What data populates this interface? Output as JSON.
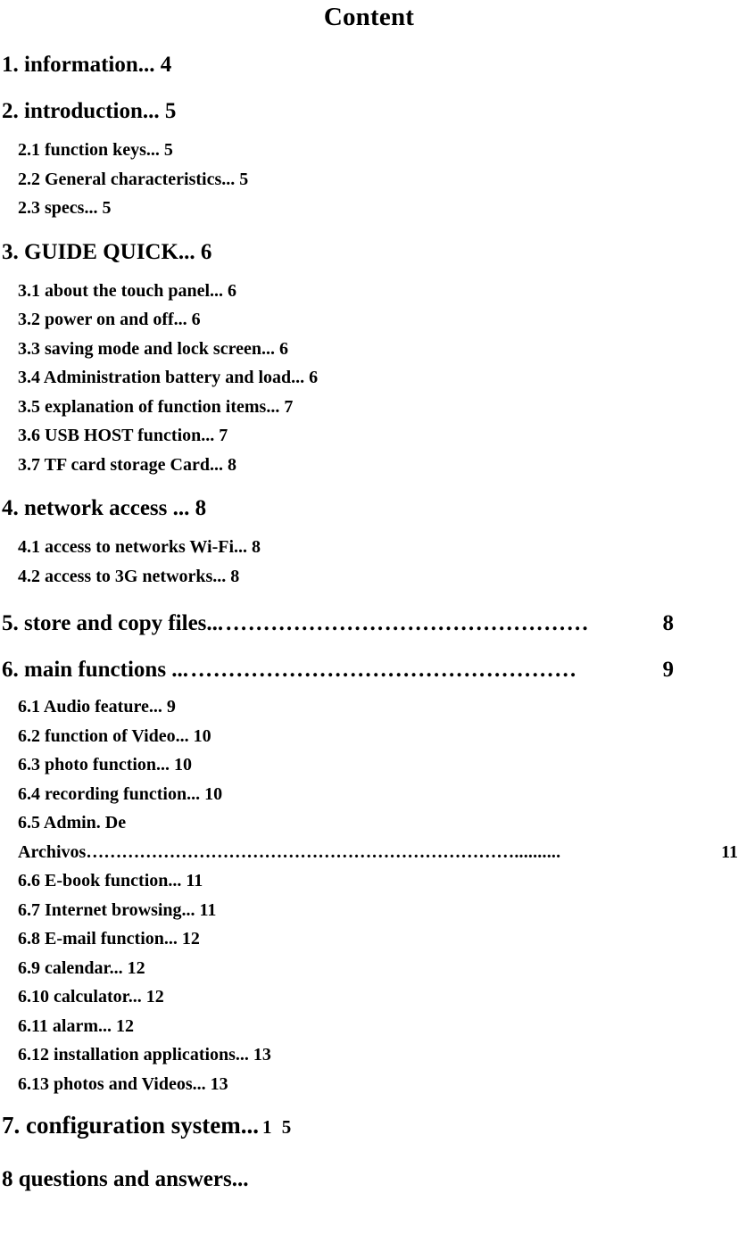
{
  "document": {
    "title": "Content"
  },
  "toc": {
    "entries": [
      {
        "id": "s1",
        "level": 1,
        "label": "1. information... 4"
      },
      {
        "id": "s2",
        "level": 1,
        "label": "2. introduction... 5"
      },
      {
        "id": "s2_1",
        "level": 2,
        "label": "2.1 function keys... 5"
      },
      {
        "id": "s2_2",
        "level": 2,
        "label": "2.2 General characteristics... 5"
      },
      {
        "id": "s2_3",
        "level": 2,
        "label": "2.3 specs... 5"
      },
      {
        "id": "s3",
        "level": 1,
        "label": "3. GUIDE QUICK... 6"
      },
      {
        "id": "s3_1",
        "level": 2,
        "label": "3.1 about the touch panel... 6"
      },
      {
        "id": "s3_2",
        "level": 2,
        "label": "3.2 power on and off... 6"
      },
      {
        "id": "s3_3",
        "level": 2,
        "label": "3.3 saving mode and lock screen... 6"
      },
      {
        "id": "s3_4",
        "level": 2,
        "label": "3.4 Administration battery and load... 6"
      },
      {
        "id": "s3_5",
        "level": 2,
        "label": "3.5 explanation of function items... 7"
      },
      {
        "id": "s3_6",
        "level": 2,
        "label": "3.6 USB HOST function... 7"
      },
      {
        "id": "s3_7",
        "level": 2,
        "label": "3.7 TF card storage Card... 8"
      },
      {
        "id": "s4",
        "level": 1,
        "label": "4. network access ... 8"
      },
      {
        "id": "s4_1",
        "level": 2,
        "label": "4.1 access to networks Wi-Fi... 8"
      },
      {
        "id": "s4_2",
        "level": 2,
        "label": "4.2 access to 3G networks... 8"
      },
      {
        "id": "s5",
        "level": 1,
        "label": "5. store and copy files...",
        "leader": "…………………………………………",
        "page": "8"
      },
      {
        "id": "s6",
        "level": 1,
        "label": "6. main functions ...",
        "leader": "……………………………………………",
        "page": "9"
      },
      {
        "id": "s6_1",
        "level": 2,
        "label": "6.1 Audio feature... 9"
      },
      {
        "id": "s6_2",
        "level": 2,
        "label": "6.2 function of Video... 10"
      },
      {
        "id": "s6_3",
        "level": 2,
        "label": "6.3 photo function... 10"
      },
      {
        "id": "s6_4",
        "level": 2,
        "label": "6.4 recording function... 10"
      },
      {
        "id": "s6_5",
        "level": 2,
        "label": "6.5 Admin. De"
      },
      {
        "id": "s6_5_cont",
        "level": 2,
        "label": "Archivos………………………………………………………………",
        "leader": "..........",
        "page": "11"
      },
      {
        "id": "s6_6",
        "level": 2,
        "label": "6.6 E-book function... 11"
      },
      {
        "id": "s6_7",
        "level": 2,
        "label": "6.7 Internet browsing... 11"
      },
      {
        "id": "s6_8",
        "level": 2,
        "label": "6.8 E-mail function... 12"
      },
      {
        "id": "s6_9",
        "level": 2,
        "label": "6.9 calendar... 12"
      },
      {
        "id": "s6_10",
        "level": 2,
        "label": "6.10 calculator... 12"
      },
      {
        "id": "s6_11",
        "level": 2,
        "label": "6.11 alarm... 12"
      },
      {
        "id": "s6_12",
        "level": 2,
        "label": "6.12 installation applications... 13"
      },
      {
        "id": "s6_13",
        "level": 2,
        "label": "6.13 photos and Videos... 13"
      },
      {
        "id": "s7",
        "level": 1,
        "label": "7. configuration system...",
        "page": "1 5"
      },
      {
        "id": "s8",
        "level": 1,
        "label": "8 questions and answers..."
      }
    ]
  }
}
